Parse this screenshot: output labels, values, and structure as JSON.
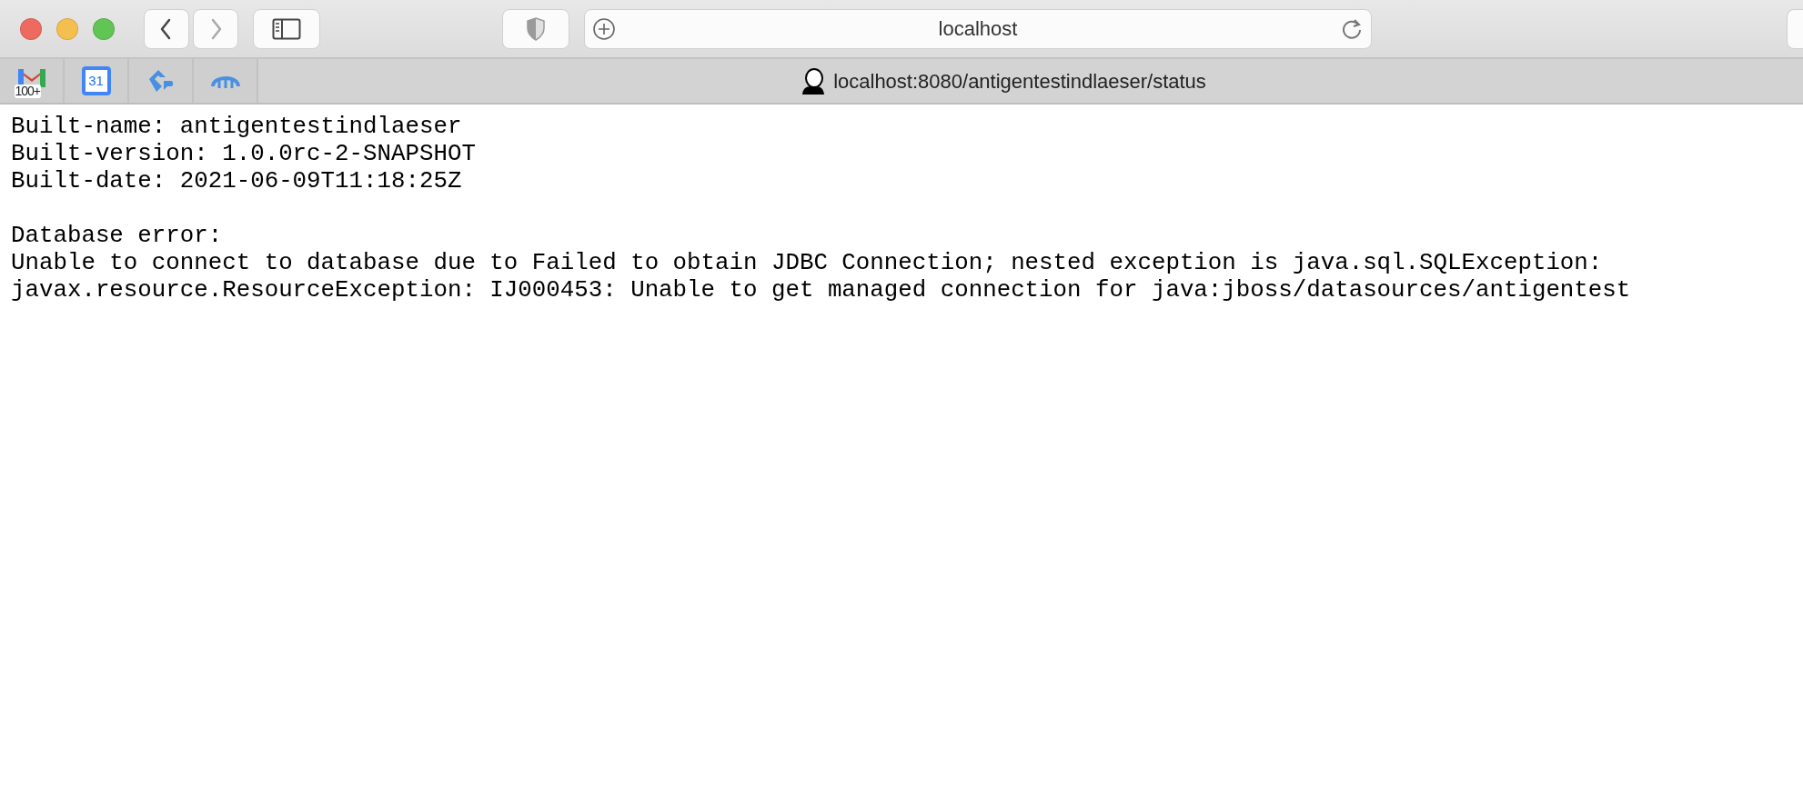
{
  "toolbar": {
    "back": {
      "disabled": false
    },
    "forward": {
      "disabled": true
    },
    "address": "localhost"
  },
  "pinned_tabs": [
    {
      "kind": "mail",
      "badge": "100+"
    },
    {
      "kind": "calendar",
      "label": "31"
    },
    {
      "kind": "ep"
    },
    {
      "kind": "cloud"
    }
  ],
  "active_tab": {
    "title": "localhost:8080/antigentestindlaeser/status"
  },
  "build_info": [
    "Built-name: antigentestindlaeser",
    "Built-version: 1.0.0rc-2-SNAPSHOT",
    "Built-date: 2021-06-09T11:18:25Z"
  ],
  "database_error": {
    "heading": "Database error:",
    "lines": [
      "Unable to connect to database due to Failed to obtain JDBC Connection; nested exception is java.sql.SQLException:",
      "javax.resource.ResourceException: IJ000453: Unable to get managed connection for java:jboss/datasources/antigentest"
    ]
  }
}
